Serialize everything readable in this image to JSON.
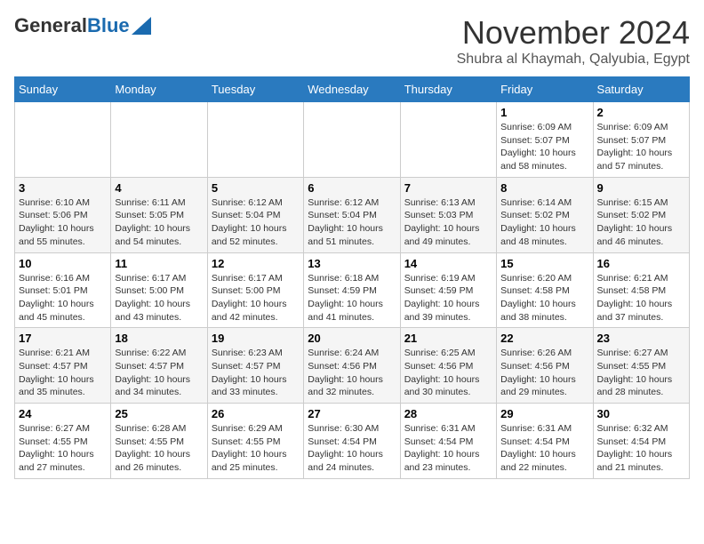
{
  "header": {
    "logo_general": "General",
    "logo_blue": "Blue",
    "title": "November 2024",
    "location": "Shubra al Khaymah, Qalyubia, Egypt"
  },
  "weekdays": [
    "Sunday",
    "Monday",
    "Tuesday",
    "Wednesday",
    "Thursday",
    "Friday",
    "Saturday"
  ],
  "weeks": [
    [
      {
        "day": "",
        "info": ""
      },
      {
        "day": "",
        "info": ""
      },
      {
        "day": "",
        "info": ""
      },
      {
        "day": "",
        "info": ""
      },
      {
        "day": "",
        "info": ""
      },
      {
        "day": "1",
        "info": "Sunrise: 6:09 AM\nSunset: 5:07 PM\nDaylight: 10 hours and 58 minutes."
      },
      {
        "day": "2",
        "info": "Sunrise: 6:09 AM\nSunset: 5:07 PM\nDaylight: 10 hours and 57 minutes."
      }
    ],
    [
      {
        "day": "3",
        "info": "Sunrise: 6:10 AM\nSunset: 5:06 PM\nDaylight: 10 hours and 55 minutes."
      },
      {
        "day": "4",
        "info": "Sunrise: 6:11 AM\nSunset: 5:05 PM\nDaylight: 10 hours and 54 minutes."
      },
      {
        "day": "5",
        "info": "Sunrise: 6:12 AM\nSunset: 5:04 PM\nDaylight: 10 hours and 52 minutes."
      },
      {
        "day": "6",
        "info": "Sunrise: 6:12 AM\nSunset: 5:04 PM\nDaylight: 10 hours and 51 minutes."
      },
      {
        "day": "7",
        "info": "Sunrise: 6:13 AM\nSunset: 5:03 PM\nDaylight: 10 hours and 49 minutes."
      },
      {
        "day": "8",
        "info": "Sunrise: 6:14 AM\nSunset: 5:02 PM\nDaylight: 10 hours and 48 minutes."
      },
      {
        "day": "9",
        "info": "Sunrise: 6:15 AM\nSunset: 5:02 PM\nDaylight: 10 hours and 46 minutes."
      }
    ],
    [
      {
        "day": "10",
        "info": "Sunrise: 6:16 AM\nSunset: 5:01 PM\nDaylight: 10 hours and 45 minutes."
      },
      {
        "day": "11",
        "info": "Sunrise: 6:17 AM\nSunset: 5:00 PM\nDaylight: 10 hours and 43 minutes."
      },
      {
        "day": "12",
        "info": "Sunrise: 6:17 AM\nSunset: 5:00 PM\nDaylight: 10 hours and 42 minutes."
      },
      {
        "day": "13",
        "info": "Sunrise: 6:18 AM\nSunset: 4:59 PM\nDaylight: 10 hours and 41 minutes."
      },
      {
        "day": "14",
        "info": "Sunrise: 6:19 AM\nSunset: 4:59 PM\nDaylight: 10 hours and 39 minutes."
      },
      {
        "day": "15",
        "info": "Sunrise: 6:20 AM\nSunset: 4:58 PM\nDaylight: 10 hours and 38 minutes."
      },
      {
        "day": "16",
        "info": "Sunrise: 6:21 AM\nSunset: 4:58 PM\nDaylight: 10 hours and 37 minutes."
      }
    ],
    [
      {
        "day": "17",
        "info": "Sunrise: 6:21 AM\nSunset: 4:57 PM\nDaylight: 10 hours and 35 minutes."
      },
      {
        "day": "18",
        "info": "Sunrise: 6:22 AM\nSunset: 4:57 PM\nDaylight: 10 hours and 34 minutes."
      },
      {
        "day": "19",
        "info": "Sunrise: 6:23 AM\nSunset: 4:57 PM\nDaylight: 10 hours and 33 minutes."
      },
      {
        "day": "20",
        "info": "Sunrise: 6:24 AM\nSunset: 4:56 PM\nDaylight: 10 hours and 32 minutes."
      },
      {
        "day": "21",
        "info": "Sunrise: 6:25 AM\nSunset: 4:56 PM\nDaylight: 10 hours and 30 minutes."
      },
      {
        "day": "22",
        "info": "Sunrise: 6:26 AM\nSunset: 4:56 PM\nDaylight: 10 hours and 29 minutes."
      },
      {
        "day": "23",
        "info": "Sunrise: 6:27 AM\nSunset: 4:55 PM\nDaylight: 10 hours and 28 minutes."
      }
    ],
    [
      {
        "day": "24",
        "info": "Sunrise: 6:27 AM\nSunset: 4:55 PM\nDaylight: 10 hours and 27 minutes."
      },
      {
        "day": "25",
        "info": "Sunrise: 6:28 AM\nSunset: 4:55 PM\nDaylight: 10 hours and 26 minutes."
      },
      {
        "day": "26",
        "info": "Sunrise: 6:29 AM\nSunset: 4:55 PM\nDaylight: 10 hours and 25 minutes."
      },
      {
        "day": "27",
        "info": "Sunrise: 6:30 AM\nSunset: 4:54 PM\nDaylight: 10 hours and 24 minutes."
      },
      {
        "day": "28",
        "info": "Sunrise: 6:31 AM\nSunset: 4:54 PM\nDaylight: 10 hours and 23 minutes."
      },
      {
        "day": "29",
        "info": "Sunrise: 6:31 AM\nSunset: 4:54 PM\nDaylight: 10 hours and 22 minutes."
      },
      {
        "day": "30",
        "info": "Sunrise: 6:32 AM\nSunset: 4:54 PM\nDaylight: 10 hours and 21 minutes."
      }
    ]
  ]
}
